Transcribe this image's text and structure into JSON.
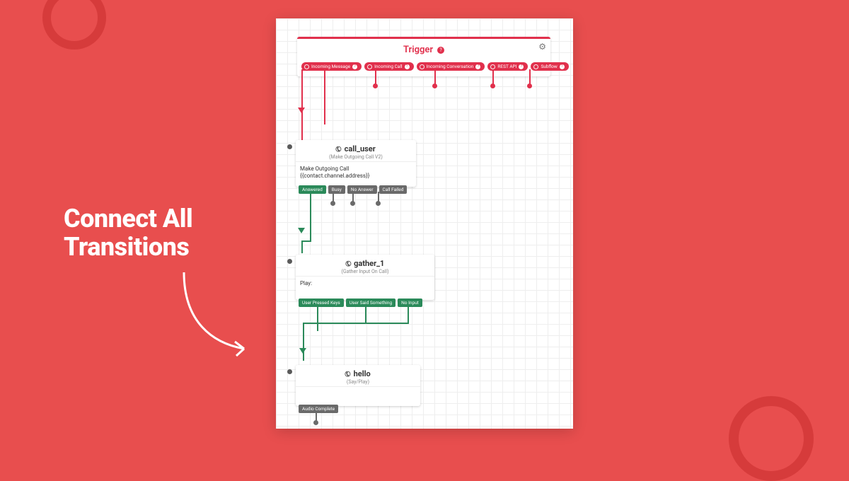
{
  "callout": {
    "line1": "Connect All",
    "line2": "Transitions"
  },
  "trigger": {
    "title": "Trigger",
    "pills": [
      "Incoming Message",
      "Incoming Call",
      "Incoming Conversation",
      "REST API",
      "Subflow"
    ]
  },
  "widgets": {
    "call_user": {
      "title": "call_user",
      "subtitle": "(Make Outgoing Call V2)",
      "body_line1": "Make Outgoing Call",
      "body_line2": "{{contact.channel.address}}",
      "tabs": [
        "Answered",
        "Busy",
        "No Answer",
        "Call Failed"
      ]
    },
    "gather_1": {
      "title": "gather_1",
      "subtitle": "(Gather Input On Call)",
      "body_line1": "Play:",
      "tabs": [
        "User Pressed Keys",
        "User Said Something",
        "No Input"
      ]
    },
    "hello": {
      "title": "hello",
      "subtitle": "(Say/Play)",
      "tabs": [
        "Audio Complete"
      ]
    }
  }
}
